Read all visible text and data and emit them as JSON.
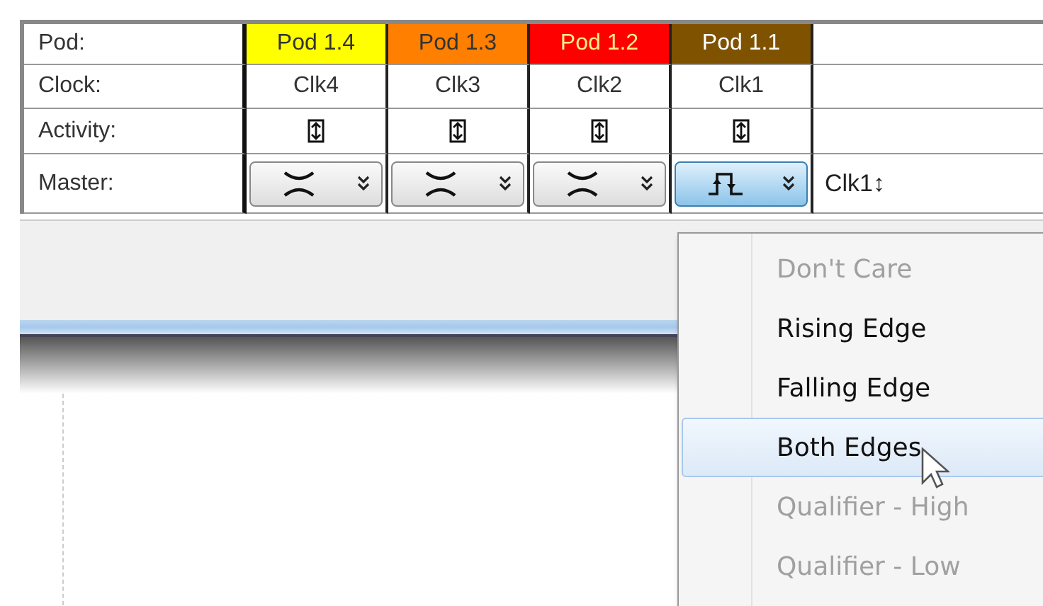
{
  "table": {
    "row_labels": [
      "Pod:",
      "Clock:",
      "Activity:",
      "Master:"
    ],
    "pods": [
      {
        "label": "Pod 1.4",
        "color": "#ffff00",
        "clock": "Clk4",
        "kind": "crossed",
        "selected": false
      },
      {
        "label": "Pod 1.3",
        "color": "#ff7f00",
        "clock": "Clk3",
        "kind": "crossed",
        "selected": false
      },
      {
        "label": "Pod 1.2",
        "color": "#ff0000",
        "clock": "Clk2",
        "kind": "crossed",
        "selected": false
      },
      {
        "label": "Pod 1.1",
        "color": "#7f5200",
        "clock": "Clk1",
        "kind": "pulse",
        "selected": true
      }
    ],
    "master_reference": "Clk1↕"
  },
  "menu": {
    "items": [
      {
        "label": "Don't Care",
        "disabled": true,
        "selected": false
      },
      {
        "label": "Rising Edge",
        "disabled": false,
        "selected": false
      },
      {
        "label": "Falling Edge",
        "disabled": false,
        "selected": false
      },
      {
        "label": "Both Edges",
        "disabled": false,
        "selected": true
      },
      {
        "label": "Qualifier - High",
        "disabled": true,
        "selected": false
      },
      {
        "label": "Qualifier - Low",
        "disabled": true,
        "selected": false
      }
    ]
  }
}
